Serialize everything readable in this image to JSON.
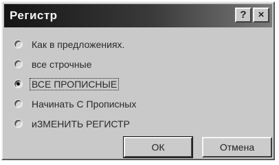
{
  "window": {
    "title": "Регистр",
    "help_label": "?",
    "close_label": "×"
  },
  "options": [
    {
      "label": "Как в предложениях.",
      "checked": false
    },
    {
      "label": "все строчные",
      "checked": false
    },
    {
      "label": "ВСЕ ПРОПИСНЫЕ",
      "checked": true
    },
    {
      "label": "Начинать С Прописных",
      "checked": false
    },
    {
      "label": "иЗМЕНИТЬ РЕГИСТР",
      "checked": false
    }
  ],
  "buttons": {
    "ok_label": "ОК",
    "cancel_label": "Отмена"
  }
}
